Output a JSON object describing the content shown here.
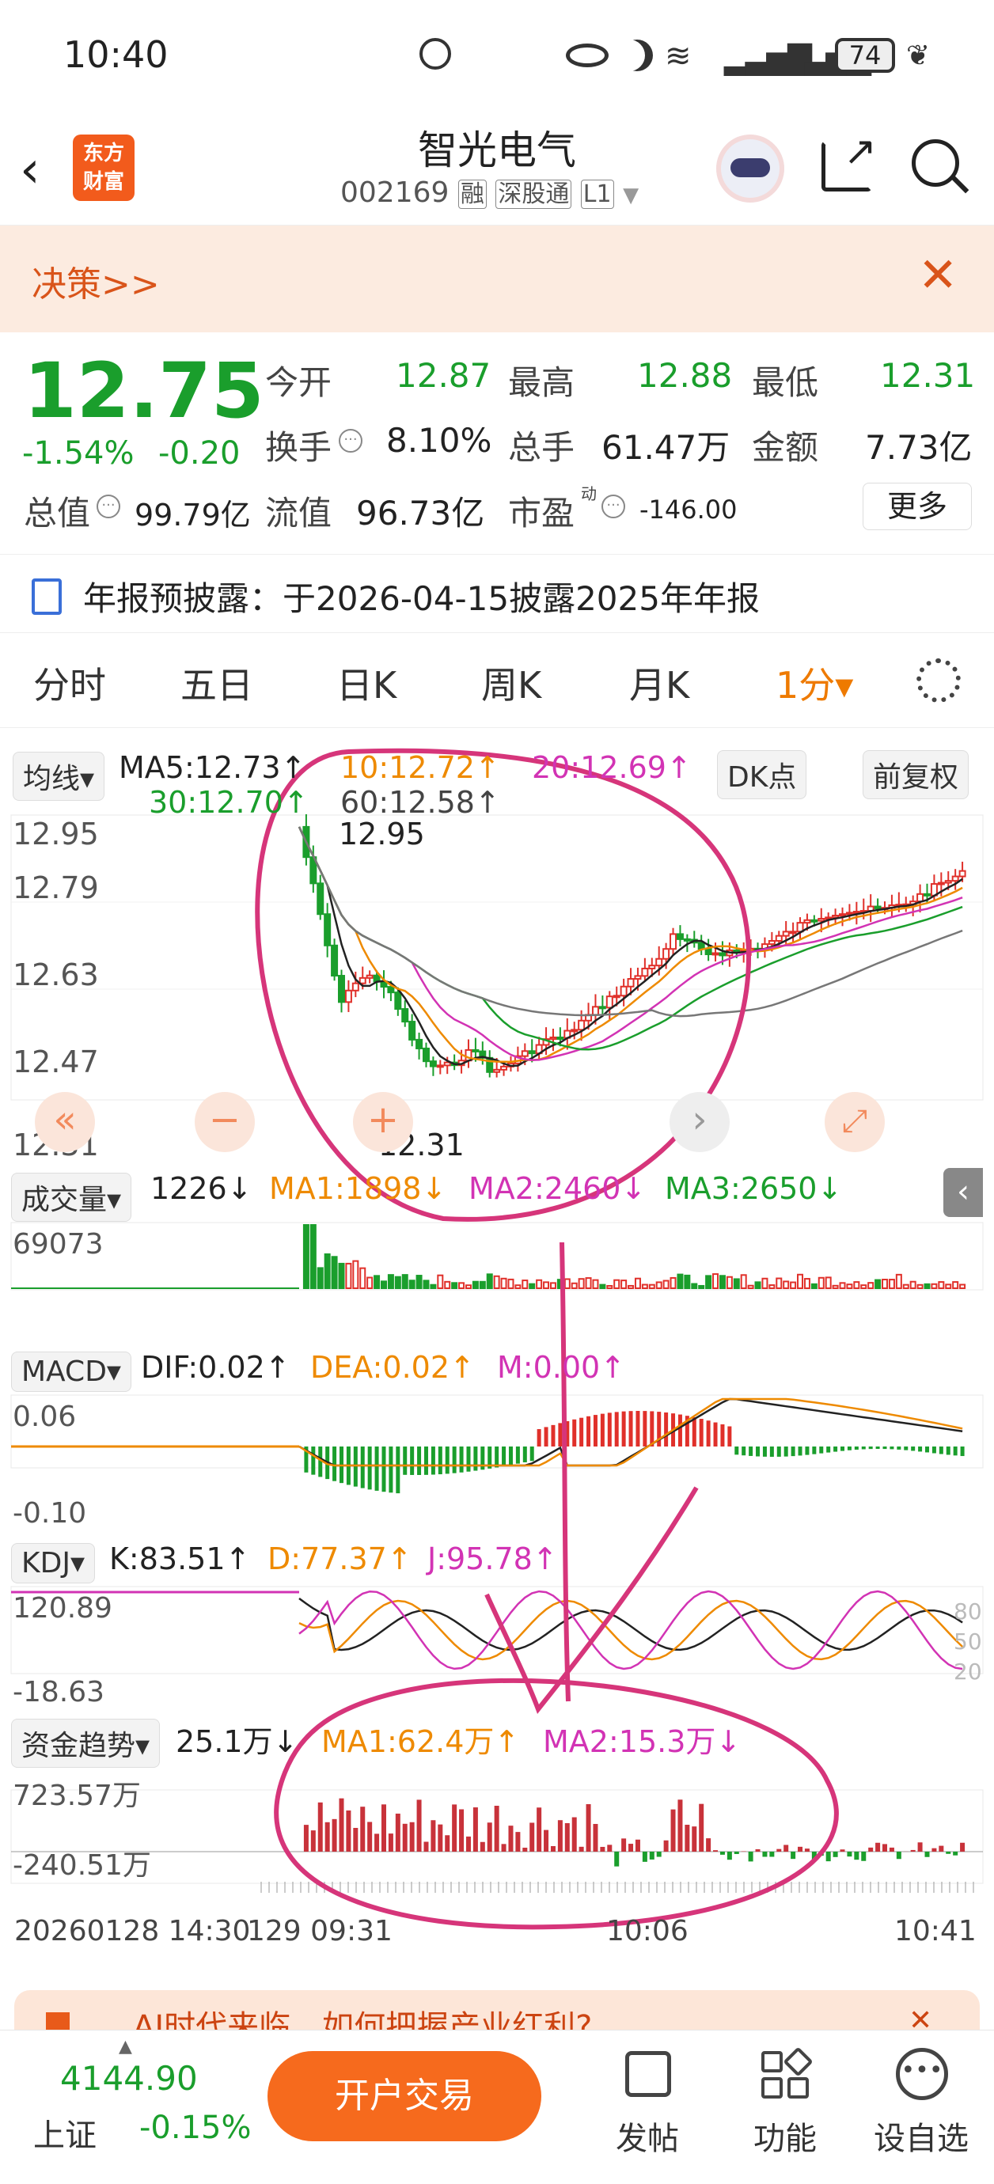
{
  "status": {
    "time": "10:40",
    "battery": "74"
  },
  "header": {
    "title": "智光电气",
    "code": "002169",
    "tags": [
      "融",
      "深股通",
      "L1"
    ],
    "logo_line1": "东方",
    "logo_line2": "财富"
  },
  "banner": {
    "label": "决策>>"
  },
  "quote": {
    "price": "12.75",
    "pct": "-1.54%",
    "chg": "-0.20",
    "open_lbl": "今开",
    "open": "12.87",
    "high_lbl": "最高",
    "high": "12.88",
    "low_lbl": "最低",
    "low": "12.31",
    "turn_lbl": "换手",
    "turn": "8.10%",
    "vol_lbl": "总手",
    "vol": "61.47万",
    "amt_lbl": "金额",
    "amt": "7.73亿",
    "mcap_lbl": "总值",
    "mcap": "99.79亿",
    "float_lbl": "流值",
    "float": "96.73亿",
    "pe_lbl": "市盈",
    "pe_sup": "动",
    "pe": "-146.00",
    "more": "更多"
  },
  "notice": {
    "text": "年报预披露：于2026-04-15披露2025年年报"
  },
  "tabs": [
    "分时",
    "五日",
    "日K",
    "周K",
    "月K",
    "1分▾"
  ],
  "chart": {
    "ma_label": "均线▾",
    "ma5": "MA5:12.73↑",
    "ma10": "10:12.72↑",
    "ma20": "20:12.69↑",
    "ma30": "30:12.70↑",
    "ma60": "60:12.58↑",
    "dk": "DK点",
    "fq": "前复权",
    "price_ticks": [
      "12.95",
      "12.79",
      "12.63",
      "12.47",
      "12.31"
    ],
    "hi_mark": "12.95",
    "lo_mark": "12.31",
    "vol_label": "成交量▾",
    "vol_val": "1226↓",
    "vol_ma1": "MA1:1898↓",
    "vol_ma2": "MA2:2460↓",
    "vol_ma3": "MA3:2650↓",
    "vol_max": "69073",
    "macd_label": "MACD▾",
    "dif": "DIF:0.02↑",
    "dea": "DEA:0.02↑",
    "m": "M:0.00↑",
    "macd_hi": "0.06",
    "macd_lo": "-0.10",
    "kdj_label": "KDJ▾",
    "k": "K:83.51↑",
    "d": "D:77.37↑",
    "j": "J:95.78↑",
    "kdj_hi": "120.89",
    "kdj_lo": "-18.63",
    "kdj_r1": "80",
    "kdj_r2": "50",
    "kdj_r3": "20",
    "fund_label": "资金趋势▾",
    "fund_val": "25.1万↓",
    "fund_ma1": "MA1:62.4万↑",
    "fund_ma2": "MA2:15.3万↓",
    "fund_hi": "723.57万",
    "fund_lo": "-240.51万",
    "time_a": "20260128 14:30",
    "time_b": "129 09:31",
    "time_c": "10:06",
    "time_d": "10:41"
  },
  "ad": {
    "text": "AI时代来临，如何把握产业红利?"
  },
  "bottom": {
    "index_val": "4144.90",
    "index_name": "上证",
    "index_pct": "-0.15%",
    "trade": "开户交易",
    "post": "发帖",
    "func": "功能",
    "watch": "设自选"
  }
}
